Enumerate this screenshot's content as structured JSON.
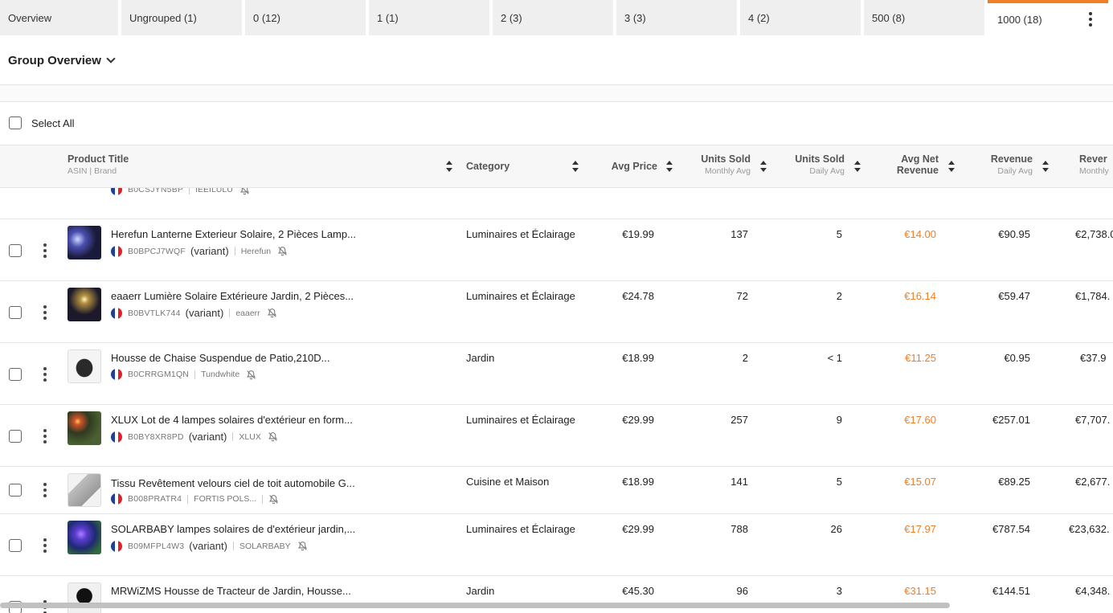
{
  "tabs": [
    {
      "label": "Overview"
    },
    {
      "label": "Ungrouped (1)"
    },
    {
      "label": "0 (12)"
    },
    {
      "label": "1 (1)"
    },
    {
      "label": "2 (3)"
    },
    {
      "label": "3 (3)"
    },
    {
      "label": "4 (2)"
    },
    {
      "label": "500 (8)"
    },
    {
      "label": "1000 (18)"
    }
  ],
  "group": {
    "title": "Group Overview"
  },
  "select_all": {
    "label": "Select All"
  },
  "columns": {
    "product_title": "Product Title",
    "product_sub": "ASIN | Brand",
    "category": "Category",
    "avg_price": "Avg Price",
    "units_sold_monthly": "Units Sold",
    "units_sold_monthly_sub": "Monthly Avg",
    "units_sold_daily": "Units Sold",
    "units_sold_daily_sub": "Daily Avg",
    "avg_net_revenue_1": "Avg Net",
    "avg_net_revenue_2": "Revenue",
    "revenue_daily": "Revenue",
    "revenue_daily_sub": "Daily Avg",
    "revenue_monthly": "Rever",
    "revenue_monthly_sub": "Monthly"
  },
  "partial_top_row": {
    "asin": "B0CSJYN5BP",
    "brand": "IEEILULU"
  },
  "rows": [
    {
      "title": "Herefun Lanterne Exterieur Solaire, 2 Pièces Lamp...",
      "asin": "B0BPCJ7WQF",
      "variant": "(variant)",
      "brand": "Herefun",
      "category": "Luminaires et Éclairage",
      "avg_price": "€19.99",
      "units_monthly": "137",
      "units_daily": "5",
      "avg_net": "€14.00",
      "rev_daily": "€90.95",
      "rev_monthly": "€2,738.0"
    },
    {
      "title": "eaaerr Lumière Solaire Extérieure Jardin, 2 Pièces...",
      "asin": "B0BVTLK744",
      "variant": "(variant)",
      "brand": "eaaerr",
      "category": "Luminaires et Éclairage",
      "avg_price": "€24.78",
      "units_monthly": "72",
      "units_daily": "2",
      "avg_net": "€16.14",
      "rev_daily": "€59.47",
      "rev_monthly": "€1,784."
    },
    {
      "title": "Housse de Chaise Suspendue de Patio,210D...",
      "asin": "B0CRRGM1QN",
      "variant": "",
      "brand": "Tundwhite",
      "category": "Jardin",
      "avg_price": "€18.99",
      "units_monthly": "2",
      "units_daily": "< 1",
      "avg_net": "€11.25",
      "rev_daily": "€0.95",
      "rev_monthly": "€37.9"
    },
    {
      "title": "XLUX Lot de 4 lampes solaires d'extérieur en form...",
      "asin": "B0BY8XR8PD",
      "variant": "(variant)",
      "brand": "XLUX",
      "category": "Luminaires et Éclairage",
      "avg_price": "€29.99",
      "units_monthly": "257",
      "units_daily": "9",
      "avg_net": "€17.60",
      "rev_daily": "€257.01",
      "rev_monthly": "€7,707."
    },
    {
      "title": "Tissu Revêtement velours ciel de toit automobile G...",
      "asin": "B008PRATR4",
      "variant": "",
      "brand": "FORTIS POLS...",
      "category": "Cuisine et Maison",
      "avg_price": "€18.99",
      "units_monthly": "141",
      "units_daily": "5",
      "avg_net": "€15.07",
      "rev_daily": "€89.25",
      "rev_monthly": "€2,677."
    },
    {
      "title": "SOLARBABY lampes solaires de d'extérieur jardin,...",
      "asin": "B09MFPL4W3",
      "variant": "(variant)",
      "brand": "SOLARBABY",
      "category": "Luminaires et Éclairage",
      "avg_price": "€29.99",
      "units_monthly": "788",
      "units_daily": "26",
      "avg_net": "€17.97",
      "rev_daily": "€787.54",
      "rev_monthly": "€23,632."
    },
    {
      "title": "MRWiZMS Housse de Tracteur de Jardin, Housse...",
      "asin": "",
      "variant": "",
      "brand": "",
      "category": "Jardin",
      "avg_price": "€45.30",
      "units_monthly": "96",
      "units_daily": "3",
      "avg_net": "€31.15",
      "rev_daily": "€144.51",
      "rev_monthly": "€4,348."
    }
  ],
  "colors": {
    "accent": "#f07e26",
    "tab_bg": "#efefef",
    "header_bg": "#f7f7f7"
  }
}
